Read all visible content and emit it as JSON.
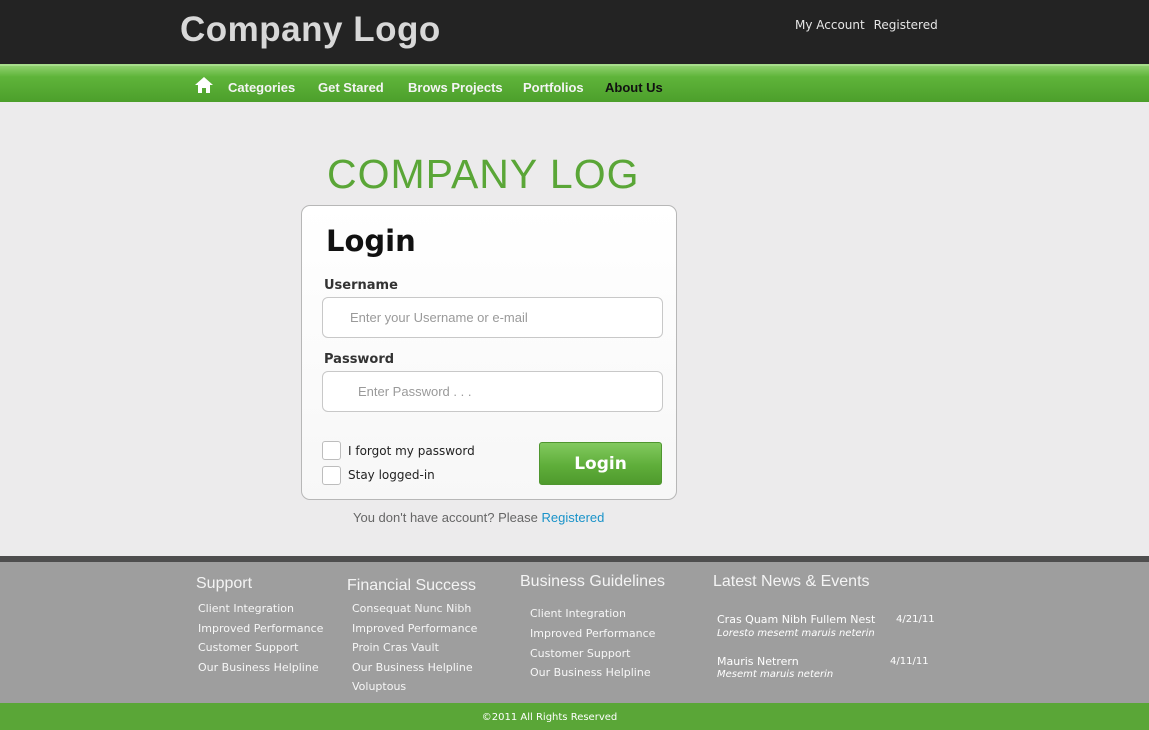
{
  "header": {
    "logo": "Company Logo",
    "my_account": "My Account",
    "registered": "Registered"
  },
  "nav": {
    "items": [
      {
        "label": "Categories"
      },
      {
        "label": "Get Stared"
      },
      {
        "label": "Brows Projects"
      },
      {
        "label": "Portfolios"
      },
      {
        "label": "About Us"
      }
    ]
  },
  "main": {
    "brand_title": "COMPANY LOG",
    "login_heading": "Login",
    "username_label": "Username",
    "username_placeholder": "Enter your Username or e-mail",
    "password_label": "Password",
    "password_placeholder": "Enter Password . . .",
    "forgot_label": "I forgot my password",
    "stay_label": "Stay logged-in",
    "login_button": "Login",
    "register_prompt": "You don't have account? Please",
    "register_link": "Registered"
  },
  "footer": {
    "support": {
      "title": "Support",
      "links": [
        "Client Integration",
        "Improved Performance",
        "Customer Support",
        "Our Business Helpline"
      ]
    },
    "financial": {
      "title": "Financial Success",
      "links": [
        "Consequat Nunc Nibh",
        "Improved Performance",
        "Proin Cras Vault",
        "Our Business Helpline",
        "Voluptous"
      ]
    },
    "business": {
      "title": "Business Guidelines",
      "links": [
        "Client Integration",
        "Improved Performance",
        "Customer Support",
        "Our Business Helpline"
      ]
    },
    "news": {
      "title": "Latest News & Events",
      "items": [
        {
          "title": "Cras Quam Nibh Fullem Nest",
          "subtitle": "Loresto mesemt maruis neterin",
          "date": "4/21/11"
        },
        {
          "title": "Mauris Netrern",
          "subtitle": "Mesemt maruis neterin",
          "date": "4/11/11"
        }
      ]
    },
    "copyright": "©2011 All Rights Reserved"
  },
  "colors": {
    "accent_green": "#5aa637",
    "header_dark": "#232323",
    "footer_gray": "#9e9e9e",
    "link_blue": "#1a93c9"
  }
}
